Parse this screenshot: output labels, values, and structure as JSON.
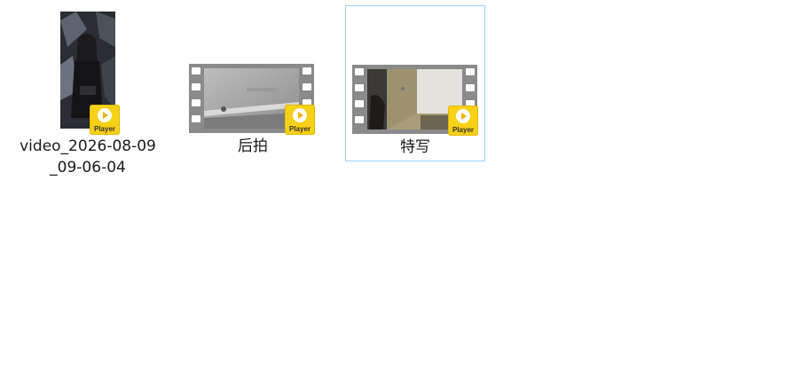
{
  "files": [
    {
      "name": "video_2026-08-09_09-06-04",
      "badge_text": "Player",
      "selected": false,
      "thumb_kind": "portrait"
    },
    {
      "name": "后拍",
      "badge_text": "Player",
      "selected": false,
      "thumb_kind": "film"
    },
    {
      "name": "特写",
      "badge_text": "Player",
      "selected": true,
      "thumb_kind": "film"
    }
  ],
  "colors": {
    "selection_border": "#99d1ff",
    "badge_yellow": "#f7d117",
    "film_gray": "#8a8a8a"
  }
}
